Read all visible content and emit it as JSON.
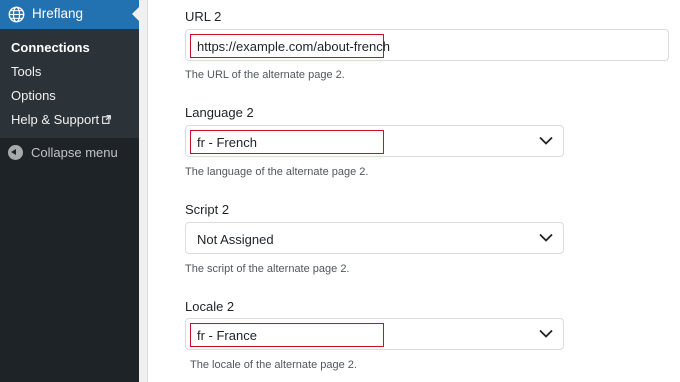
{
  "sidebar": {
    "menu_title": "Hreflang",
    "menu_icon": "globe-icon",
    "items": [
      {
        "label": "Connections",
        "current": true
      },
      {
        "label": "Tools"
      },
      {
        "label": "Options"
      },
      {
        "label": "Help & Support",
        "icon": "external-link-icon"
      }
    ],
    "collapse_label": "Collapse menu",
    "accent_color": "#2271b1"
  },
  "form": {
    "url": {
      "label": "URL 2",
      "value": "https://example.com/about-french",
      "description": "The URL of the alternate page 2."
    },
    "language": {
      "label": "Language 2",
      "value": "fr - French",
      "description": "The language of the alternate page 2."
    },
    "script": {
      "label": "Script 2",
      "value": "Not Assigned",
      "description": "The script of the alternate page 2."
    },
    "locale": {
      "label": "Locale 2",
      "value": "fr - France",
      "description": "The locale of the alternate page 2."
    },
    "highlight_color": "#c8102e"
  }
}
